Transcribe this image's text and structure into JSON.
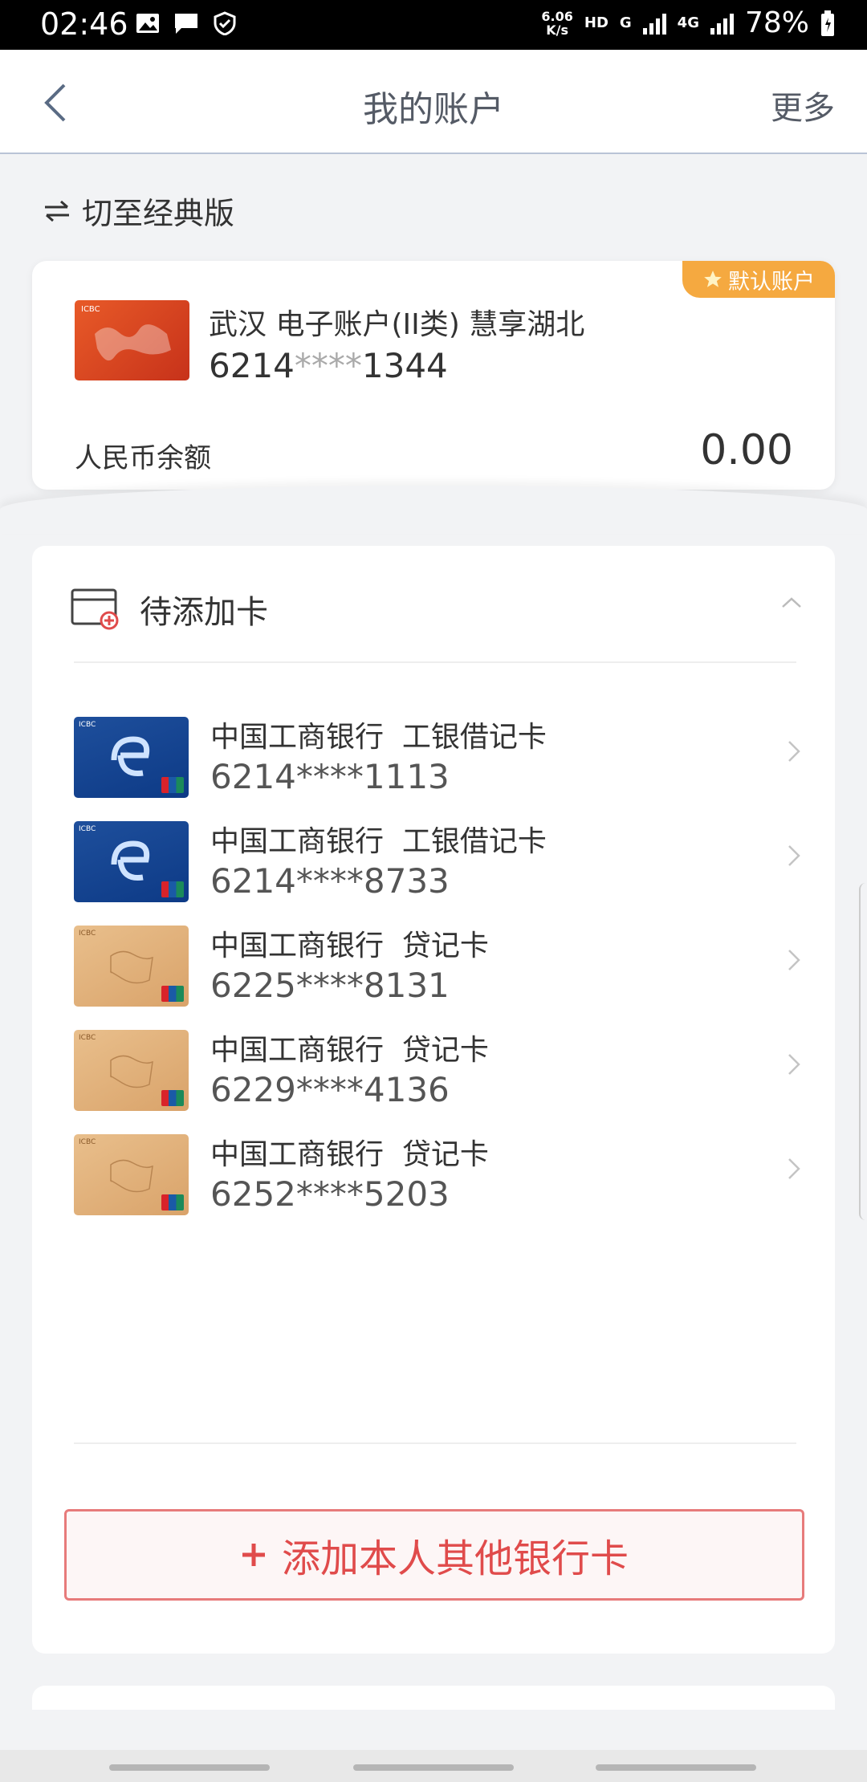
{
  "status_bar": {
    "time": "02:46",
    "speed_value": "6.06",
    "speed_unit": "K/s",
    "hd": "HD",
    "net1": "G",
    "net2": "4G",
    "battery": "78%"
  },
  "header": {
    "title": "我的账户",
    "more": "更多"
  },
  "switch_label": "切至经典版",
  "default_account": {
    "badge": "默认账户",
    "name": "武汉 电子账户(II类) 慧享湖北",
    "number_prefix": "6214",
    "number_mask": "****",
    "number_suffix": "1344",
    "balance_label": "人民币余额",
    "balance": "0.00"
  },
  "pending": {
    "title": "待添加卡",
    "cards": [
      {
        "bank": "中国工商银行",
        "type": "工银借记卡",
        "number": "6214****1113",
        "style": "blue"
      },
      {
        "bank": "中国工商银行",
        "type": "工银借记卡",
        "number": "6214****8733",
        "style": "blue"
      },
      {
        "bank": "中国工商银行",
        "type": "贷记卡",
        "number": "6225****8131",
        "style": "tan"
      },
      {
        "bank": "中国工商银行",
        "type": "贷记卡",
        "number": "6229****4136",
        "style": "tan"
      },
      {
        "bank": "中国工商银行",
        "type": "贷记卡",
        "number": "6252****5203",
        "style": "tan"
      }
    ]
  },
  "add_button": {
    "label": "添加本人其他银行卡"
  },
  "colors": {
    "accent_red": "#e04b4b",
    "badge_orange": "#f5a940",
    "header_border": "#b9c3d6"
  }
}
